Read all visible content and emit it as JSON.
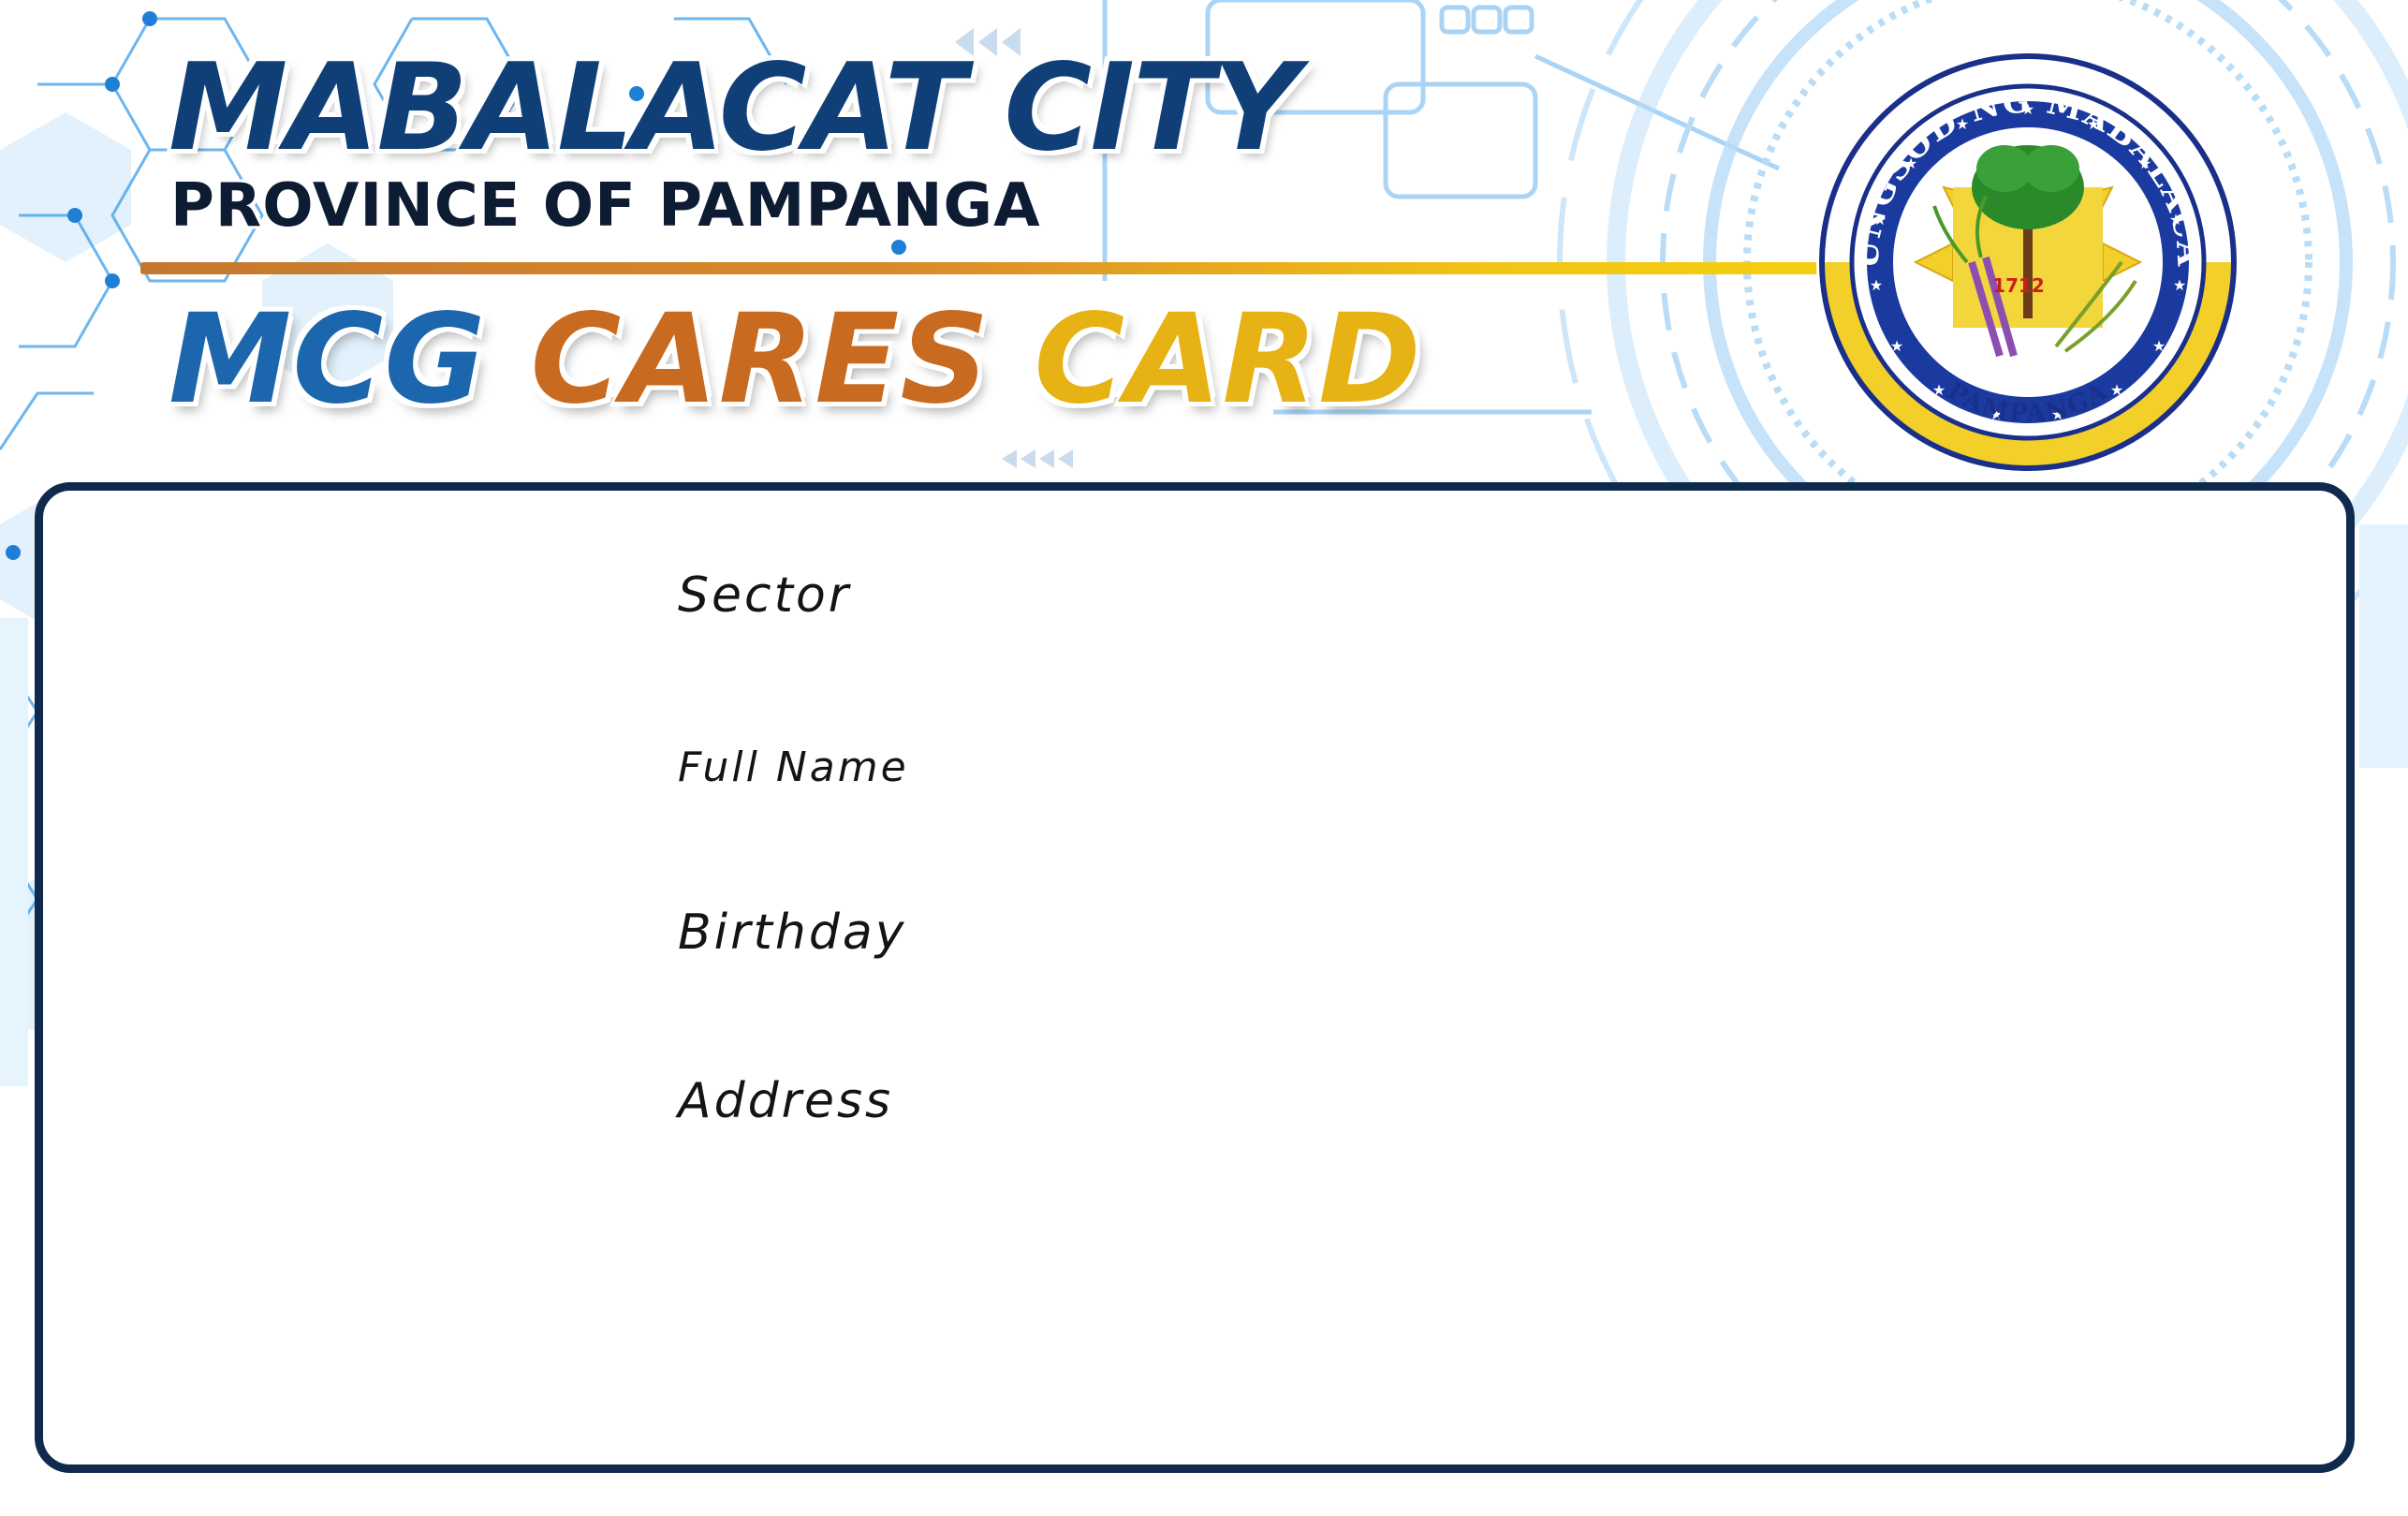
{
  "header": {
    "city": "MABALACAT CITY",
    "province": "PROVINCE OF PAMPANGA",
    "card_title_word1": "MCG",
    "card_title_word2": "CARES",
    "card_title_word3": "CARD"
  },
  "seal": {
    "top_text": "LUNGSOD NG MABALACAT",
    "bottom_text": "PAMPANGA",
    "year": "1712"
  },
  "fields": [
    {
      "label": "Sector",
      "value": ""
    },
    {
      "label": "Full Name",
      "value": ""
    },
    {
      "label": "Birthday",
      "value": ""
    },
    {
      "label": "Address",
      "value": ""
    }
  ],
  "colors": {
    "navy": "#0f2a4d",
    "title_blue": "#103f78",
    "accent_blue": "#1c66ad",
    "accent_orange": "#c86a20",
    "accent_gold": "#e6b214",
    "seal_green": "#2a7a2a"
  }
}
